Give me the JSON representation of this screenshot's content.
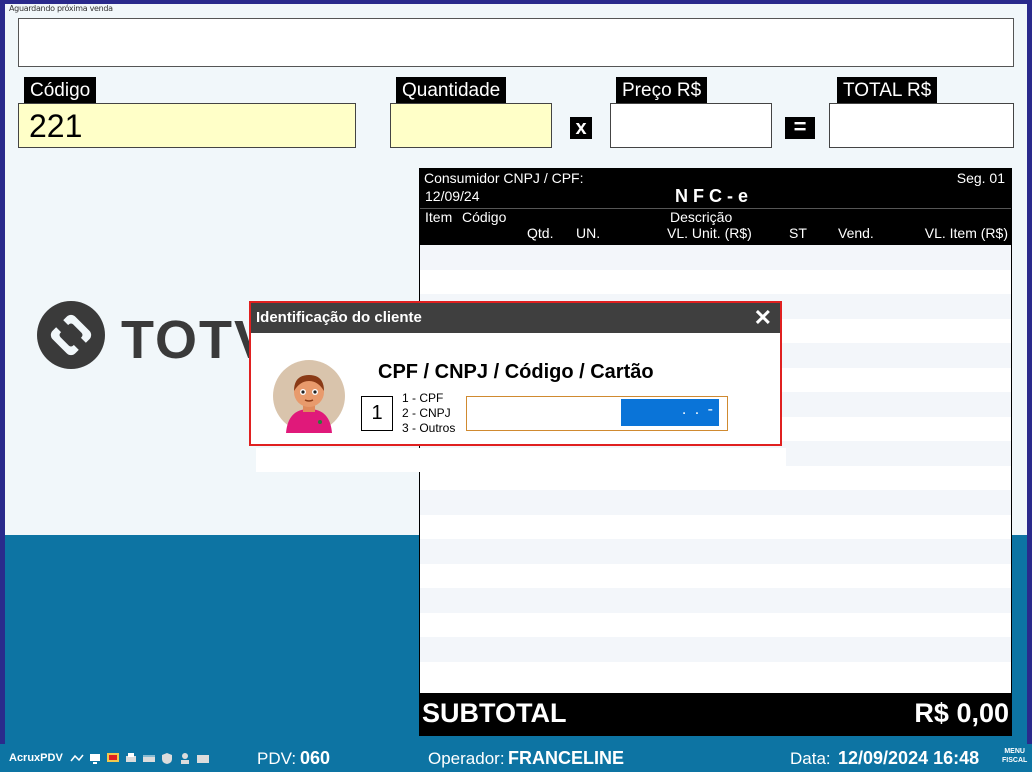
{
  "top_caption": "Aguardando próxima venda",
  "fields": {
    "codigo_label": "Código",
    "codigo_value": "221",
    "quantidade_label": "Quantidade",
    "quantidade_value": "",
    "preco_label": "Preço R$",
    "preco_value": "",
    "total_label": "TOTAL R$",
    "total_value": "",
    "times_sign": "x",
    "equals_sign": "="
  },
  "logo": {
    "text": "TOTVS"
  },
  "receipt": {
    "consumidor": "Consumidor CNPJ / CPF:",
    "date": "12/09/24",
    "title": "N F C - e",
    "seg": "Seg. 01",
    "col_item": "Item",
    "col_codigo": "Código",
    "col_descricao": "Descrição",
    "col_qtd": "Qtd.",
    "col_un": "UN.",
    "col_vl_unit": "VL. Unit. (R$)",
    "col_st": "ST",
    "col_vend": "Vend.",
    "col_vl_item": "VL. Item (R$)",
    "subtotal_label": "SUBTOTAL",
    "subtotal_value": "R$ 0,00"
  },
  "dialog": {
    "title": "Identificação do cliente",
    "close": "✕",
    "heading": "CPF / CNPJ / Código / Cartão",
    "option_selected": "1",
    "options": [
      "1 - CPF",
      "2 - CNPJ",
      "3 - Outros"
    ],
    "input_mask": ". . -"
  },
  "statusbar": {
    "app": "AcruxPDV",
    "pdv_label": "PDV:",
    "pdv_value": "060",
    "operador_label": "Operador:",
    "operador_value": "FRANCELINE",
    "data_label": "Data:",
    "data_value": "12/09/2024 16:48",
    "menu_line1": "MENU",
    "menu_line2": "FISCAL"
  },
  "colors": {
    "background": "#f1f7fa",
    "band": "#0d74a3",
    "dialog_border": "#e02020",
    "input_highlight": "#0a74d8",
    "yellow_field": "#ffffc8"
  }
}
